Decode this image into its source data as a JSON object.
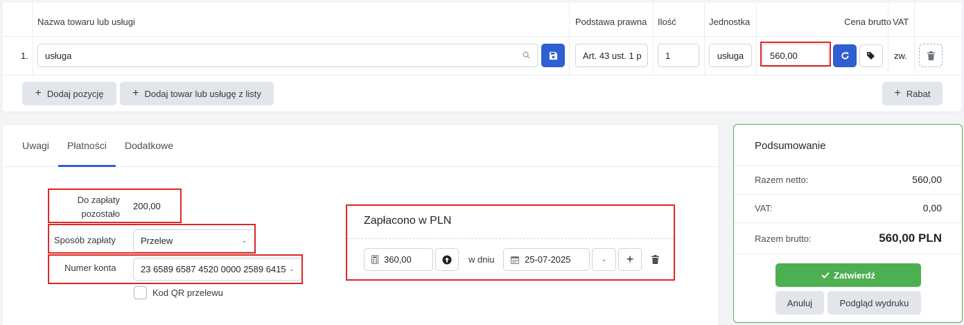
{
  "items_table": {
    "headers": {
      "name": "Nazwa towaru lub usługi",
      "legal_basis": "Podstawa prawna",
      "quantity": "Ilość",
      "unit": "Jednostka",
      "gross_price": "Cena brutto",
      "vat": "VAT"
    },
    "rows": [
      {
        "no": "1.",
        "name": "usługa",
        "legal_basis": "Art. 43 ust. 1 p",
        "quantity": "1",
        "unit": "usługa",
        "gross_price": "560,00",
        "vat": "zw."
      }
    ],
    "add_item_label": "Dodaj pozycję",
    "add_from_list_label": "Dodaj towar lub usługę z listy",
    "discount_label": "Rabat"
  },
  "tabs": [
    {
      "label": "Uwagi",
      "active": false
    },
    {
      "label": "Płatności",
      "active": true
    },
    {
      "label": "Dodatkowe",
      "active": false
    }
  ],
  "payment": {
    "remaining_label": "Do zapłaty pozostało",
    "remaining_value": "200,00",
    "method_label": "Sposób zapłaty",
    "method_value": "Przelew",
    "account_label": "Numer konta",
    "account_value": "23 6589 6587 4520 0000 2589 6415",
    "qr_label": "Kod QR przelewu"
  },
  "paid": {
    "title": "Zapłacono w PLN",
    "amount": "360,00",
    "date_label": "w dniu",
    "date": "25-07-2025"
  },
  "summary": {
    "title": "Podsumowanie",
    "net_label": "Razem netto:",
    "net_value": "560,00",
    "vat_label": "VAT:",
    "vat_value": "0,00",
    "gross_label": "Razem brutto:",
    "gross_value": "560,00 PLN",
    "approve_label": "Zatwierdź",
    "cancel_label": "Anuluj",
    "preview_label": "Podgląd wydruku"
  },
  "colors": {
    "primary": "#2f5fd0",
    "success": "#4caf50",
    "highlight": "#dc2626",
    "tab_active": "#2f5fd0"
  }
}
